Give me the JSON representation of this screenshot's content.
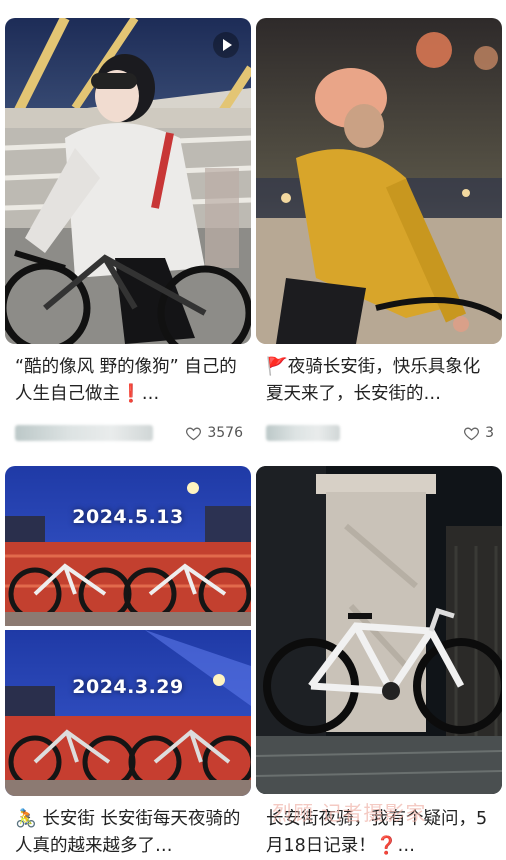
{
  "feed": {
    "cards": [
      {
        "title": "“酷的像风 野的像狗” 自己的人生自己做主❗…",
        "likes": "3576",
        "is_video": true
      },
      {
        "title": "🚩夜骑长安街，快乐具象化 夏天来了，长安街的…",
        "likes": "3"
      },
      {
        "title": "🚴 长安街 长安街每天夜骑的人真的越来越多了…",
        "photo_dates": [
          "2024.5.13",
          "2024.3.29"
        ]
      },
      {
        "title": "长安街夜骑，我有个疑问，5月18日记录！❓…",
        "watermark": "烈顾 记者摄影家"
      }
    ]
  },
  "icons": {
    "like": "heart-outline-icon",
    "video": "play-icon"
  }
}
